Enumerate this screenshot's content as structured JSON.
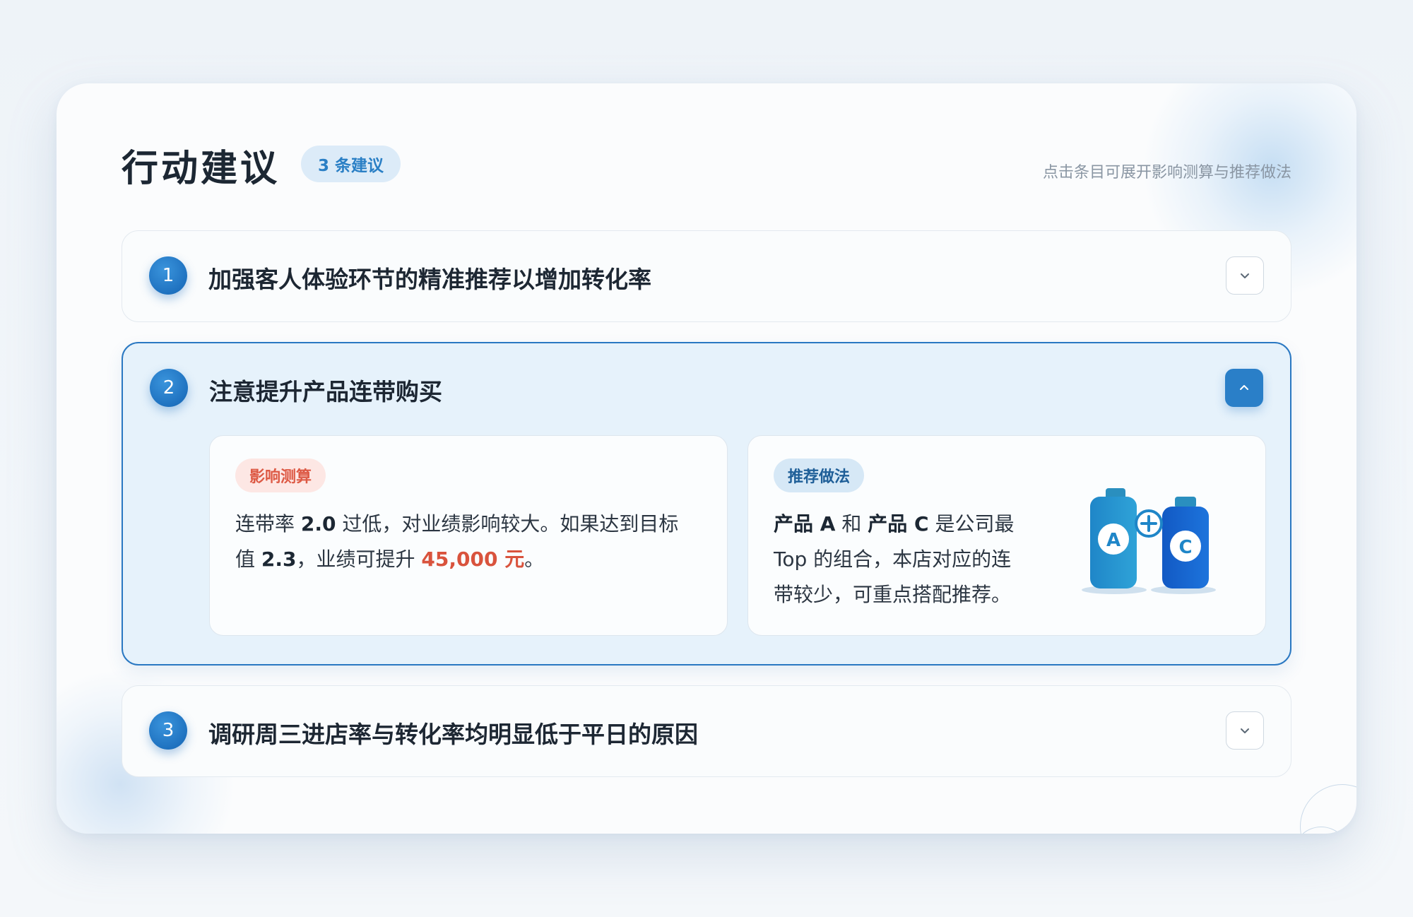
{
  "header": {
    "title": "行动建议",
    "count_badge": "3 条建议",
    "hint": "点击条目可展开影响测算与推荐做法"
  },
  "items": [
    {
      "number": "1",
      "title": "加强客人体验环节的精准推荐以增加转化率",
      "expanded": false
    },
    {
      "number": "2",
      "title": "注意提升产品连带购买",
      "expanded": true
    },
    {
      "number": "3",
      "title": "调研周三进店率与转化率均明显低于平日的原因",
      "expanded": false
    }
  ],
  "detail": {
    "impact": {
      "tag": "影响测算",
      "t1": "连带率 ",
      "v1": "2.0",
      "t2": " 过低，对业绩影响较大。如果达到目标",
      "t3": "值 ",
      "v2": "2.3",
      "t4": "，业绩可提升 ",
      "amount": "45,000 元",
      "t5": "。"
    },
    "practice": {
      "tag": "推荐做法",
      "p1": "产品 A",
      "t1": " 和 ",
      "p2": "产品 C",
      "t2": " 是公司最",
      "t3": "Top 的组合，本店对应的连",
      "t4": "带较少，可重点搭配推荐。",
      "illustration": {
        "left_label": "A",
        "right_label": "C",
        "plus_icon": "plus-icon"
      }
    }
  },
  "colors": {
    "accent": "#2a7fc8",
    "number_badge": "#1f72c0",
    "highlight_red": "#d9533d",
    "expanded_bg": "#e6f2fb"
  }
}
